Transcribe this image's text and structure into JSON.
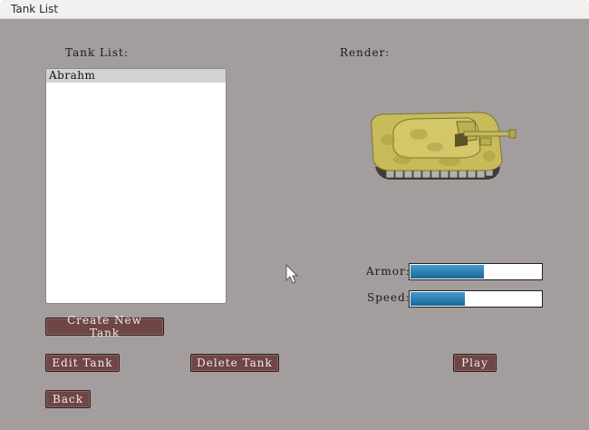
{
  "window": {
    "title": "Tank List"
  },
  "labels": {
    "tank_list": "Tank List:",
    "render": "Render:",
    "armor": "Armor:",
    "speed": "Speed:"
  },
  "tank_list": {
    "items": [
      {
        "label": "Abrahm",
        "selected": true
      }
    ]
  },
  "stats": {
    "armor": 0.56,
    "speed": 0.42,
    "fill_color": "#2f83b3"
  },
  "buttons": {
    "create": "Create New Tank",
    "edit": "Edit Tank",
    "delete": "Delete Tank",
    "play": "Play",
    "back": "Back"
  },
  "render": {
    "model": "tank-model",
    "color": "#c8bc5a"
  }
}
